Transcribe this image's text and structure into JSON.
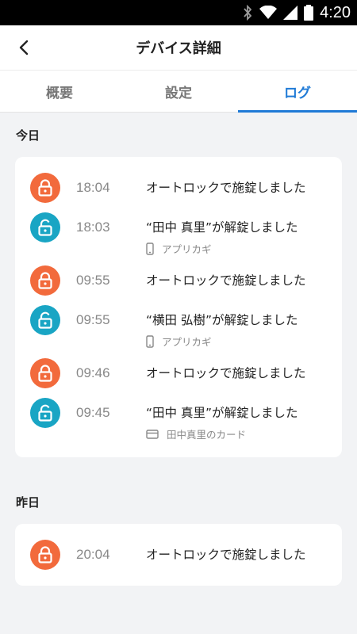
{
  "status_bar": {
    "time": "4:20",
    "icons": [
      "bluetooth-icon",
      "wifi-icon",
      "cell-signal-icon",
      "battery-icon"
    ]
  },
  "app_bar": {
    "title": "デバイス詳細",
    "back_icon": "back-arrow-icon"
  },
  "tabs": [
    {
      "label": "概要",
      "active": false
    },
    {
      "label": "設定",
      "active": false
    },
    {
      "label": "ログ",
      "active": true
    }
  ],
  "colors": {
    "accent": "#1f7ad6",
    "lock": "#f26a3c",
    "unlock": "#19a5c4"
  },
  "sections": [
    {
      "title": "今日",
      "logs": [
        {
          "type": "lock",
          "icon": "lock-icon",
          "time": "18:04",
          "message": "オートロックで施錠しました",
          "sub": ""
        },
        {
          "type": "unlock",
          "icon": "unlock-icon",
          "time": "18:03",
          "message": "“田中 真里”が解錠しました",
          "sub": "アプリカギ",
          "sub_icon": "phone-icon"
        },
        {
          "type": "lock",
          "icon": "lock-icon",
          "time": "09:55",
          "message": "オートロックで施錠しました",
          "sub": ""
        },
        {
          "type": "unlock",
          "icon": "unlock-icon",
          "time": "09:55",
          "message": "“横田 弘樹”が解錠しました",
          "sub": "アプリカギ",
          "sub_icon": "phone-icon"
        },
        {
          "type": "lock",
          "icon": "lock-icon",
          "time": "09:46",
          "message": "オートロックで施錠しました",
          "sub": ""
        },
        {
          "type": "unlock",
          "icon": "unlock-icon",
          "time": "09:45",
          "message": "“田中 真里”が解錠しました",
          "sub": "田中真里のカード",
          "sub_icon": "card-icon"
        }
      ]
    },
    {
      "title": "昨日",
      "logs": [
        {
          "type": "lock",
          "icon": "lock-icon",
          "time": "20:04",
          "message": "オートロックで施錠しました",
          "sub": ""
        }
      ]
    }
  ]
}
